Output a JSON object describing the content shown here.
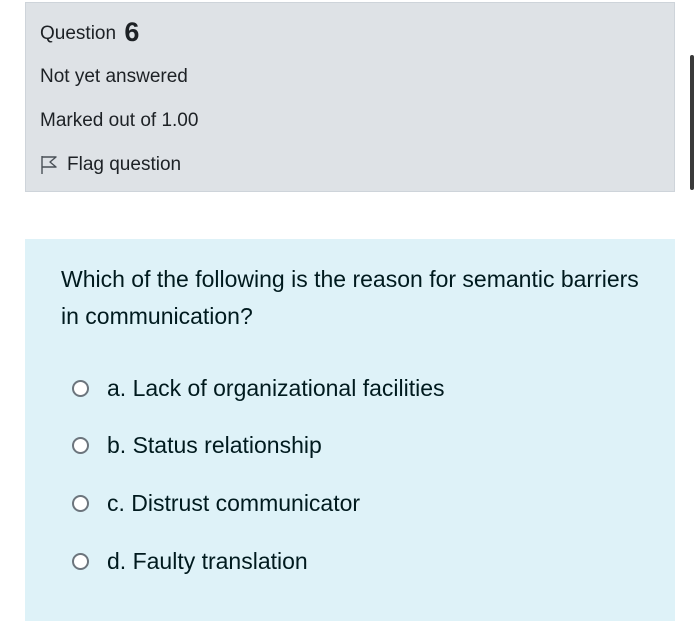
{
  "info": {
    "question_label": "Question",
    "question_number": "6",
    "state": "Not yet answered",
    "grade": "Marked out of 1.00",
    "flag_label": "Flag question",
    "flag_icon": "flag-icon"
  },
  "question": {
    "text": "Which of the following is the reason for semantic barriers in communication?",
    "options": [
      {
        "label": "a. Lack of organizational facilities"
      },
      {
        "label": "b. Status relationship"
      },
      {
        "label": "c. Distrust communicator"
      },
      {
        "label": "d. Faulty translation"
      }
    ]
  },
  "colors": {
    "info_bg": "#dee2e6",
    "question_bg": "#def2f8",
    "text": "#001a1e"
  }
}
